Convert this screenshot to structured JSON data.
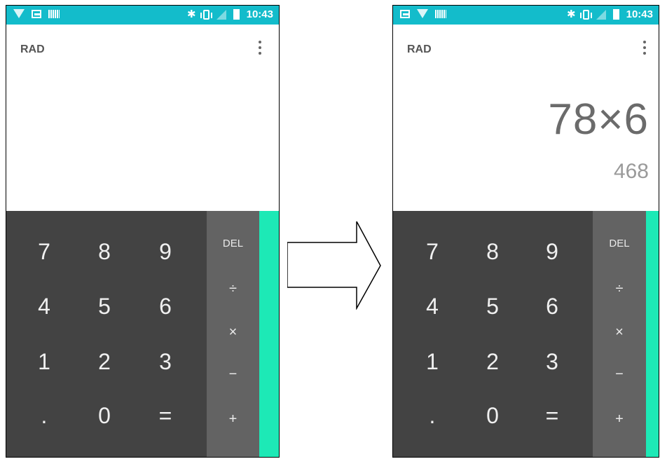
{
  "status_bar": {
    "time": "10:43",
    "bluetooth_icon": "bluetooth-icon",
    "colors": {
      "background": "#13bccb"
    }
  },
  "calculator": {
    "mode": "RAD",
    "keys": {
      "digits": [
        "7",
        "8",
        "9",
        "4",
        "5",
        "6",
        "1",
        "2",
        "3",
        ".",
        "0",
        "="
      ],
      "ops": [
        "DEL",
        "÷",
        "×",
        "−",
        "+"
      ]
    },
    "accent_color": "#1de9b6"
  },
  "before": {
    "formula": "",
    "result": ""
  },
  "after": {
    "formula": "78×6",
    "result": "468"
  },
  "bluetooth_glyph": "✱"
}
